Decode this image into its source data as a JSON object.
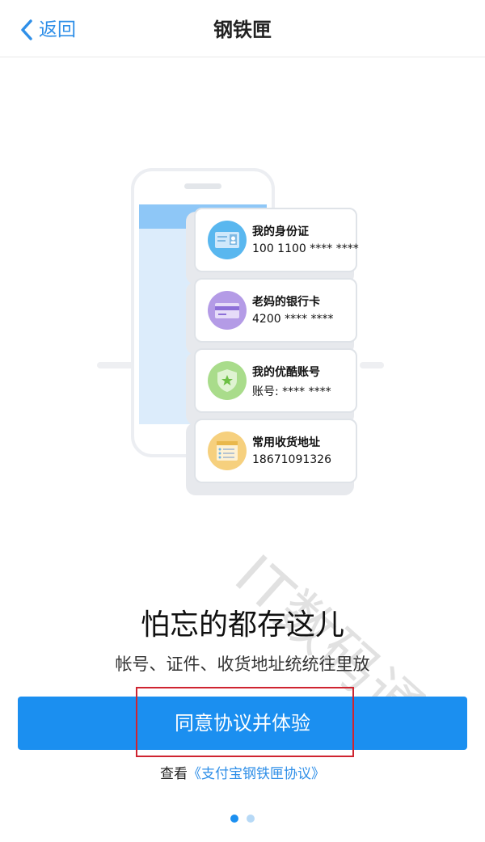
{
  "navbar": {
    "back_label": "返回",
    "title": "钢铁匣"
  },
  "cards": [
    {
      "title": "我的身份证",
      "subtitle": "100 1100 **** ****",
      "icon": "id-card-icon",
      "color": "#59b7ef"
    },
    {
      "title": "老妈的银行卡",
      "subtitle": "4200 **** ****",
      "icon": "bank-card-icon",
      "color": "#b49be6"
    },
    {
      "title": "我的优酷账号",
      "subtitle": "账号: **** ****",
      "icon": "shield-star-icon",
      "color": "#a9dc8b"
    },
    {
      "title": "常用收货地址",
      "subtitle": "18671091326",
      "icon": "address-list-icon",
      "color": "#f6d07e"
    }
  ],
  "watermark": "IT数码通",
  "main": {
    "headline": "怕忘的都存这儿",
    "subline": "帐号、证件、收货地址统统往里放"
  },
  "cta": {
    "label": "同意协议并体验"
  },
  "agreement": {
    "prefix": "查看",
    "link_text": "《支付宝钢铁匣协议》"
  },
  "pagination": {
    "total": 2,
    "current": 1
  },
  "colors": {
    "accent": "#1b8ff0",
    "link": "#2f8fe8",
    "highlight": "#cf2430"
  }
}
